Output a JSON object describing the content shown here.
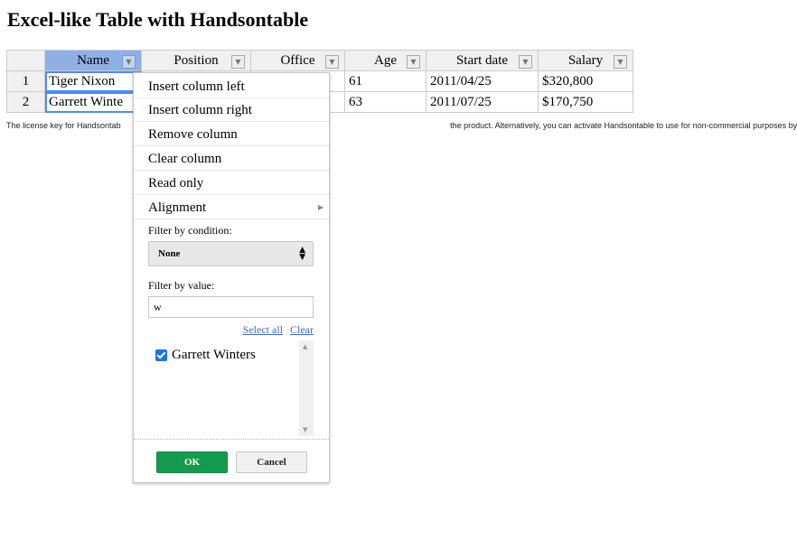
{
  "page": {
    "title": "Excel-like Table with Handsontable",
    "license_left": "The license key for Handsontab",
    "license_right": "the product. Alternatively, you can activate Handsontable to use for non-commercial purposes by passing the key: 'nc"
  },
  "table": {
    "columns": [
      "Name",
      "Position",
      "Office",
      "Age",
      "Start date",
      "Salary"
    ],
    "rows": [
      {
        "num": "1",
        "name": "Tiger Nixon",
        "age": "61",
        "start": "2011/04/25",
        "salary": "$320,800"
      },
      {
        "num": "2",
        "name": "Garrett Winte",
        "age": "63",
        "start": "2011/07/25",
        "salary": "$170,750"
      }
    ],
    "filter_icon": "dropdown-arrow-icon"
  },
  "menu": {
    "items": [
      "Insert column left",
      "Insert column right",
      "Remove column",
      "Clear column",
      "Read only",
      "Alignment"
    ],
    "filter_condition_label": "Filter by condition:",
    "condition_value": "None",
    "filter_value_label": "Filter by value:",
    "search_value": "w",
    "select_all": "Select all",
    "clear": "Clear",
    "values": [
      {
        "label": "Garrett Winters",
        "checked": true
      }
    ],
    "ok": "OK",
    "cancel": "Cancel"
  },
  "colors": {
    "ok_button": "#159b4e",
    "selected_header": "#8eb0e7",
    "checkbox": "#1a73e8"
  }
}
